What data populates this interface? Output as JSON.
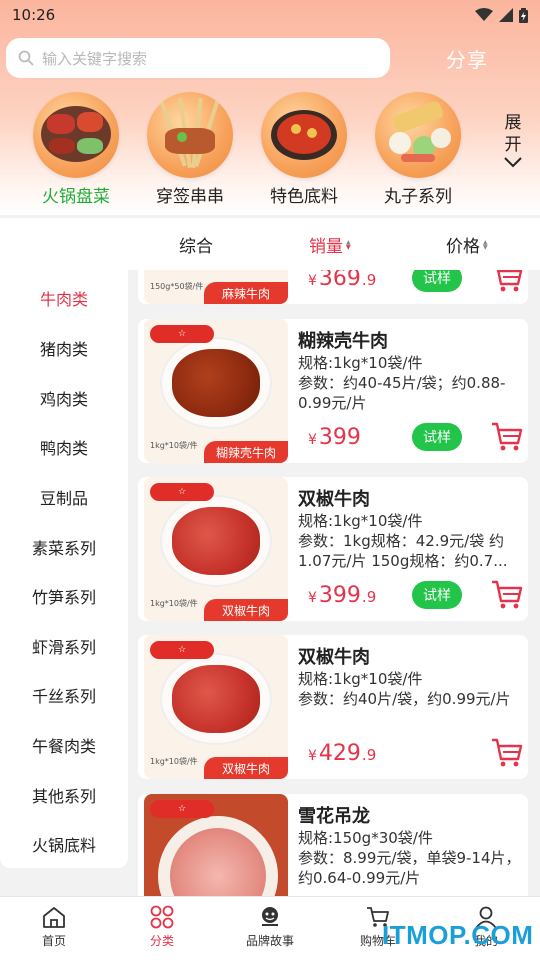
{
  "status_bar": {
    "time": "10:26"
  },
  "search": {
    "placeholder": "输入关键字搜索"
  },
  "share_label": "分享",
  "categories": [
    {
      "label": "火锅盘菜",
      "active": true
    },
    {
      "label": "穿签串串",
      "active": false
    },
    {
      "label": "特色底料",
      "active": false
    },
    {
      "label": "丸子系列",
      "active": false
    }
  ],
  "expand_label_1": "展",
  "expand_label_2": "开",
  "sort": {
    "comprehensive": "综合",
    "sales": "销量",
    "price": "价格"
  },
  "left_nav": [
    {
      "label": "牛肉类",
      "active": true
    },
    {
      "label": "猪肉类",
      "active": false
    },
    {
      "label": "鸡肉类",
      "active": false
    },
    {
      "label": "鸭肉类",
      "active": false
    },
    {
      "label": "豆制品",
      "active": false
    },
    {
      "label": "素菜系列",
      "active": false
    },
    {
      "label": "竹笋系列",
      "active": false
    },
    {
      "label": "虾滑系列",
      "active": false
    },
    {
      "label": "千丝系列",
      "active": false
    },
    {
      "label": "午餐肉类",
      "active": false
    },
    {
      "label": "其他系列",
      "active": false
    },
    {
      "label": "火锅底料",
      "active": false
    }
  ],
  "trial_label": "试样",
  "currency": "¥",
  "products": [
    {
      "title": "",
      "spec": "",
      "param": "",
      "price_int": "369",
      "price_dec": ".9",
      "has_trial": true,
      "image_spec": "150g*50袋/件",
      "image_name": "麻辣牛肉",
      "dark": true
    },
    {
      "title": "糊辣壳牛肉",
      "spec": "规格:1kg*10袋/件",
      "param": "参数：约40-45片/袋；约0.88-0.99元/片",
      "price_int": "399",
      "price_dec": "",
      "has_trial": true,
      "image_spec": "1kg*10袋/件",
      "image_name": "糊辣壳牛肉",
      "dark": true
    },
    {
      "title": "双椒牛肉",
      "spec": "规格:1kg*10袋/件",
      "param": "参数：1kg规格：42.9元/袋 约1.07元/片 150g规格：约0.7...",
      "price_int": "399",
      "price_dec": ".9",
      "has_trial": true,
      "image_spec": "1kg*10袋/件",
      "image_name": "双椒牛肉",
      "dark": false
    },
    {
      "title": "双椒牛肉",
      "spec": "规格:1kg*10袋/件",
      "param": "参数：约40片/袋，约0.99元/片",
      "price_int": "429",
      "price_dec": ".9",
      "has_trial": false,
      "image_spec": "1kg*10袋/件",
      "image_name": "双椒牛肉",
      "dark": false
    },
    {
      "title": "雪花吊龙",
      "spec": "规格:150g*30袋/件",
      "param": "参数：8.99元/袋，单袋9-14片，约0.64-0.99元/片",
      "price_int": "",
      "price_dec": "",
      "has_trial": false,
      "image_spec": "",
      "image_name": "",
      "dark": false
    }
  ],
  "bottom_nav": [
    {
      "label": "首页",
      "icon": "home-icon",
      "active": false
    },
    {
      "label": "分类",
      "icon": "category-icon",
      "active": true
    },
    {
      "label": "品牌故事",
      "icon": "brand-icon",
      "active": false
    },
    {
      "label": "购物车",
      "icon": "cart-icon",
      "active": false
    },
    {
      "label": "我的",
      "icon": "user-icon",
      "active": false
    }
  ],
  "watermark": "ITMOP.COM",
  "colors": {
    "accent_red": "#e5344a",
    "trial_green": "#22c54a",
    "active_category_green": "#1fae3a"
  }
}
